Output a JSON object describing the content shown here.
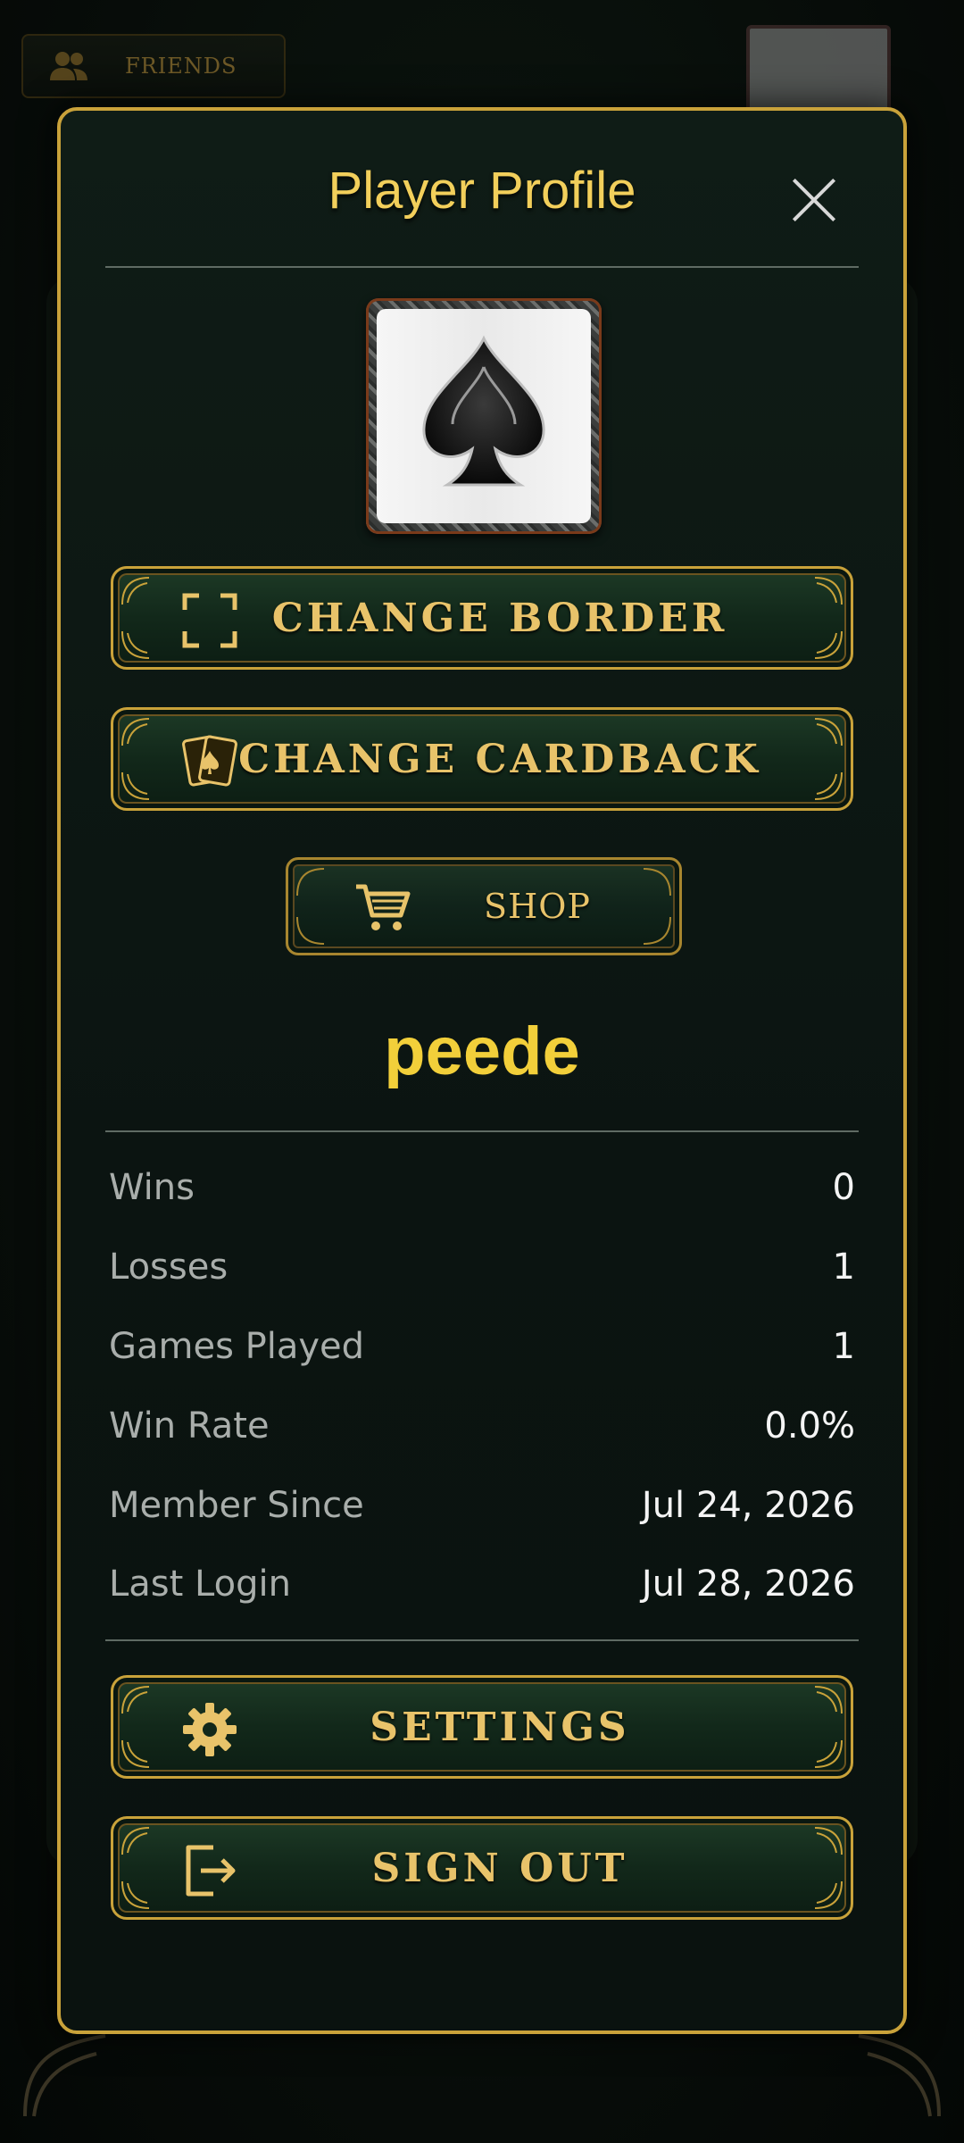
{
  "background": {
    "friends_label": "FRIENDS"
  },
  "modal": {
    "title": "Player Profile",
    "avatar_icon": "spade-card-icon"
  },
  "buttons": {
    "change_border": "CHANGE BORDER",
    "change_cardback": "CHANGE CARDBACK",
    "shop": "SHOP",
    "settings": "SETTINGS",
    "sign_out": "SIGN OUT"
  },
  "profile": {
    "username": "peede",
    "stats": [
      {
        "label": "Wins",
        "value": "0"
      },
      {
        "label": "Losses",
        "value": "1"
      },
      {
        "label": "Games Played",
        "value": "1"
      },
      {
        "label": "Win Rate",
        "value": "0.0%"
      },
      {
        "label": "Member Since",
        "value": "Jul 24, 2026"
      },
      {
        "label": "Last Login",
        "value": "Jul 28, 2026"
      }
    ]
  },
  "colors": {
    "gold": "#c9a23a",
    "title_gold": "#f2cf5b",
    "panel_green": "#0f1c16"
  }
}
